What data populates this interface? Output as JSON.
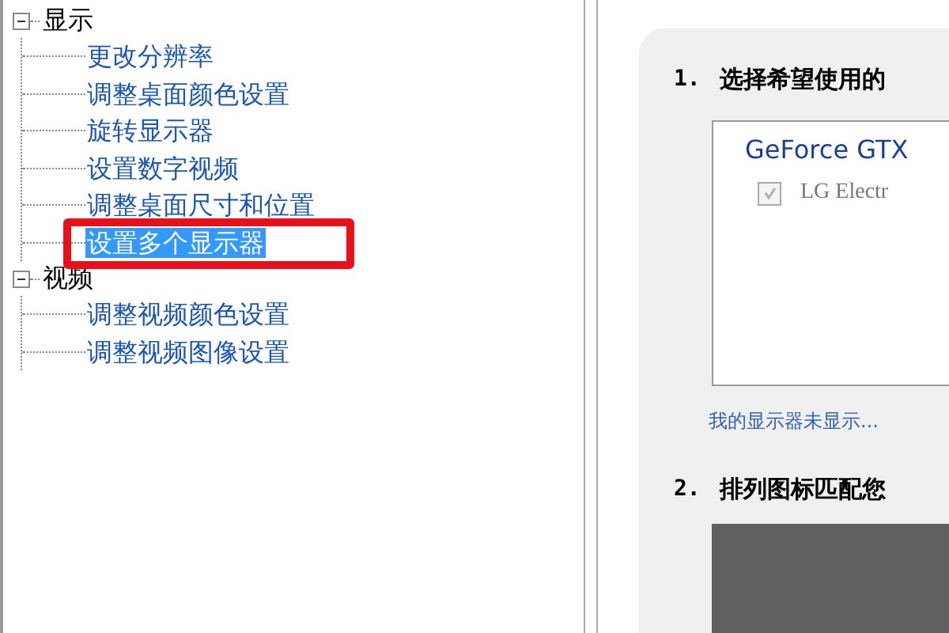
{
  "tree": [
    {
      "label": "显示",
      "expanded": true,
      "children": [
        {
          "label": "更改分辨率",
          "selected": false
        },
        {
          "label": "调整桌面颜色设置",
          "selected": false
        },
        {
          "label": "旋转显示器",
          "selected": false
        },
        {
          "label": "设置数字视频",
          "selected": false
        },
        {
          "label": "调整桌面尺寸和位置",
          "selected": false
        },
        {
          "label": "设置多个显示器",
          "selected": true
        }
      ]
    },
    {
      "label": "视频",
      "expanded": true,
      "children": [
        {
          "label": "调整视频颜色设置",
          "selected": false
        },
        {
          "label": "调整视频图像设置",
          "selected": false
        }
      ]
    }
  ],
  "steps": [
    {
      "number": "1.",
      "title": "选择希望使用的",
      "kind": "display-list",
      "gpu": "GeForce GTX",
      "displays": [
        {
          "label": "LG Electr",
          "checked": true,
          "disabled": true
        }
      ],
      "link": "我的显示器未显示..."
    },
    {
      "number": "2.",
      "title": "排列图标匹配您",
      "kind": "arrange"
    }
  ]
}
